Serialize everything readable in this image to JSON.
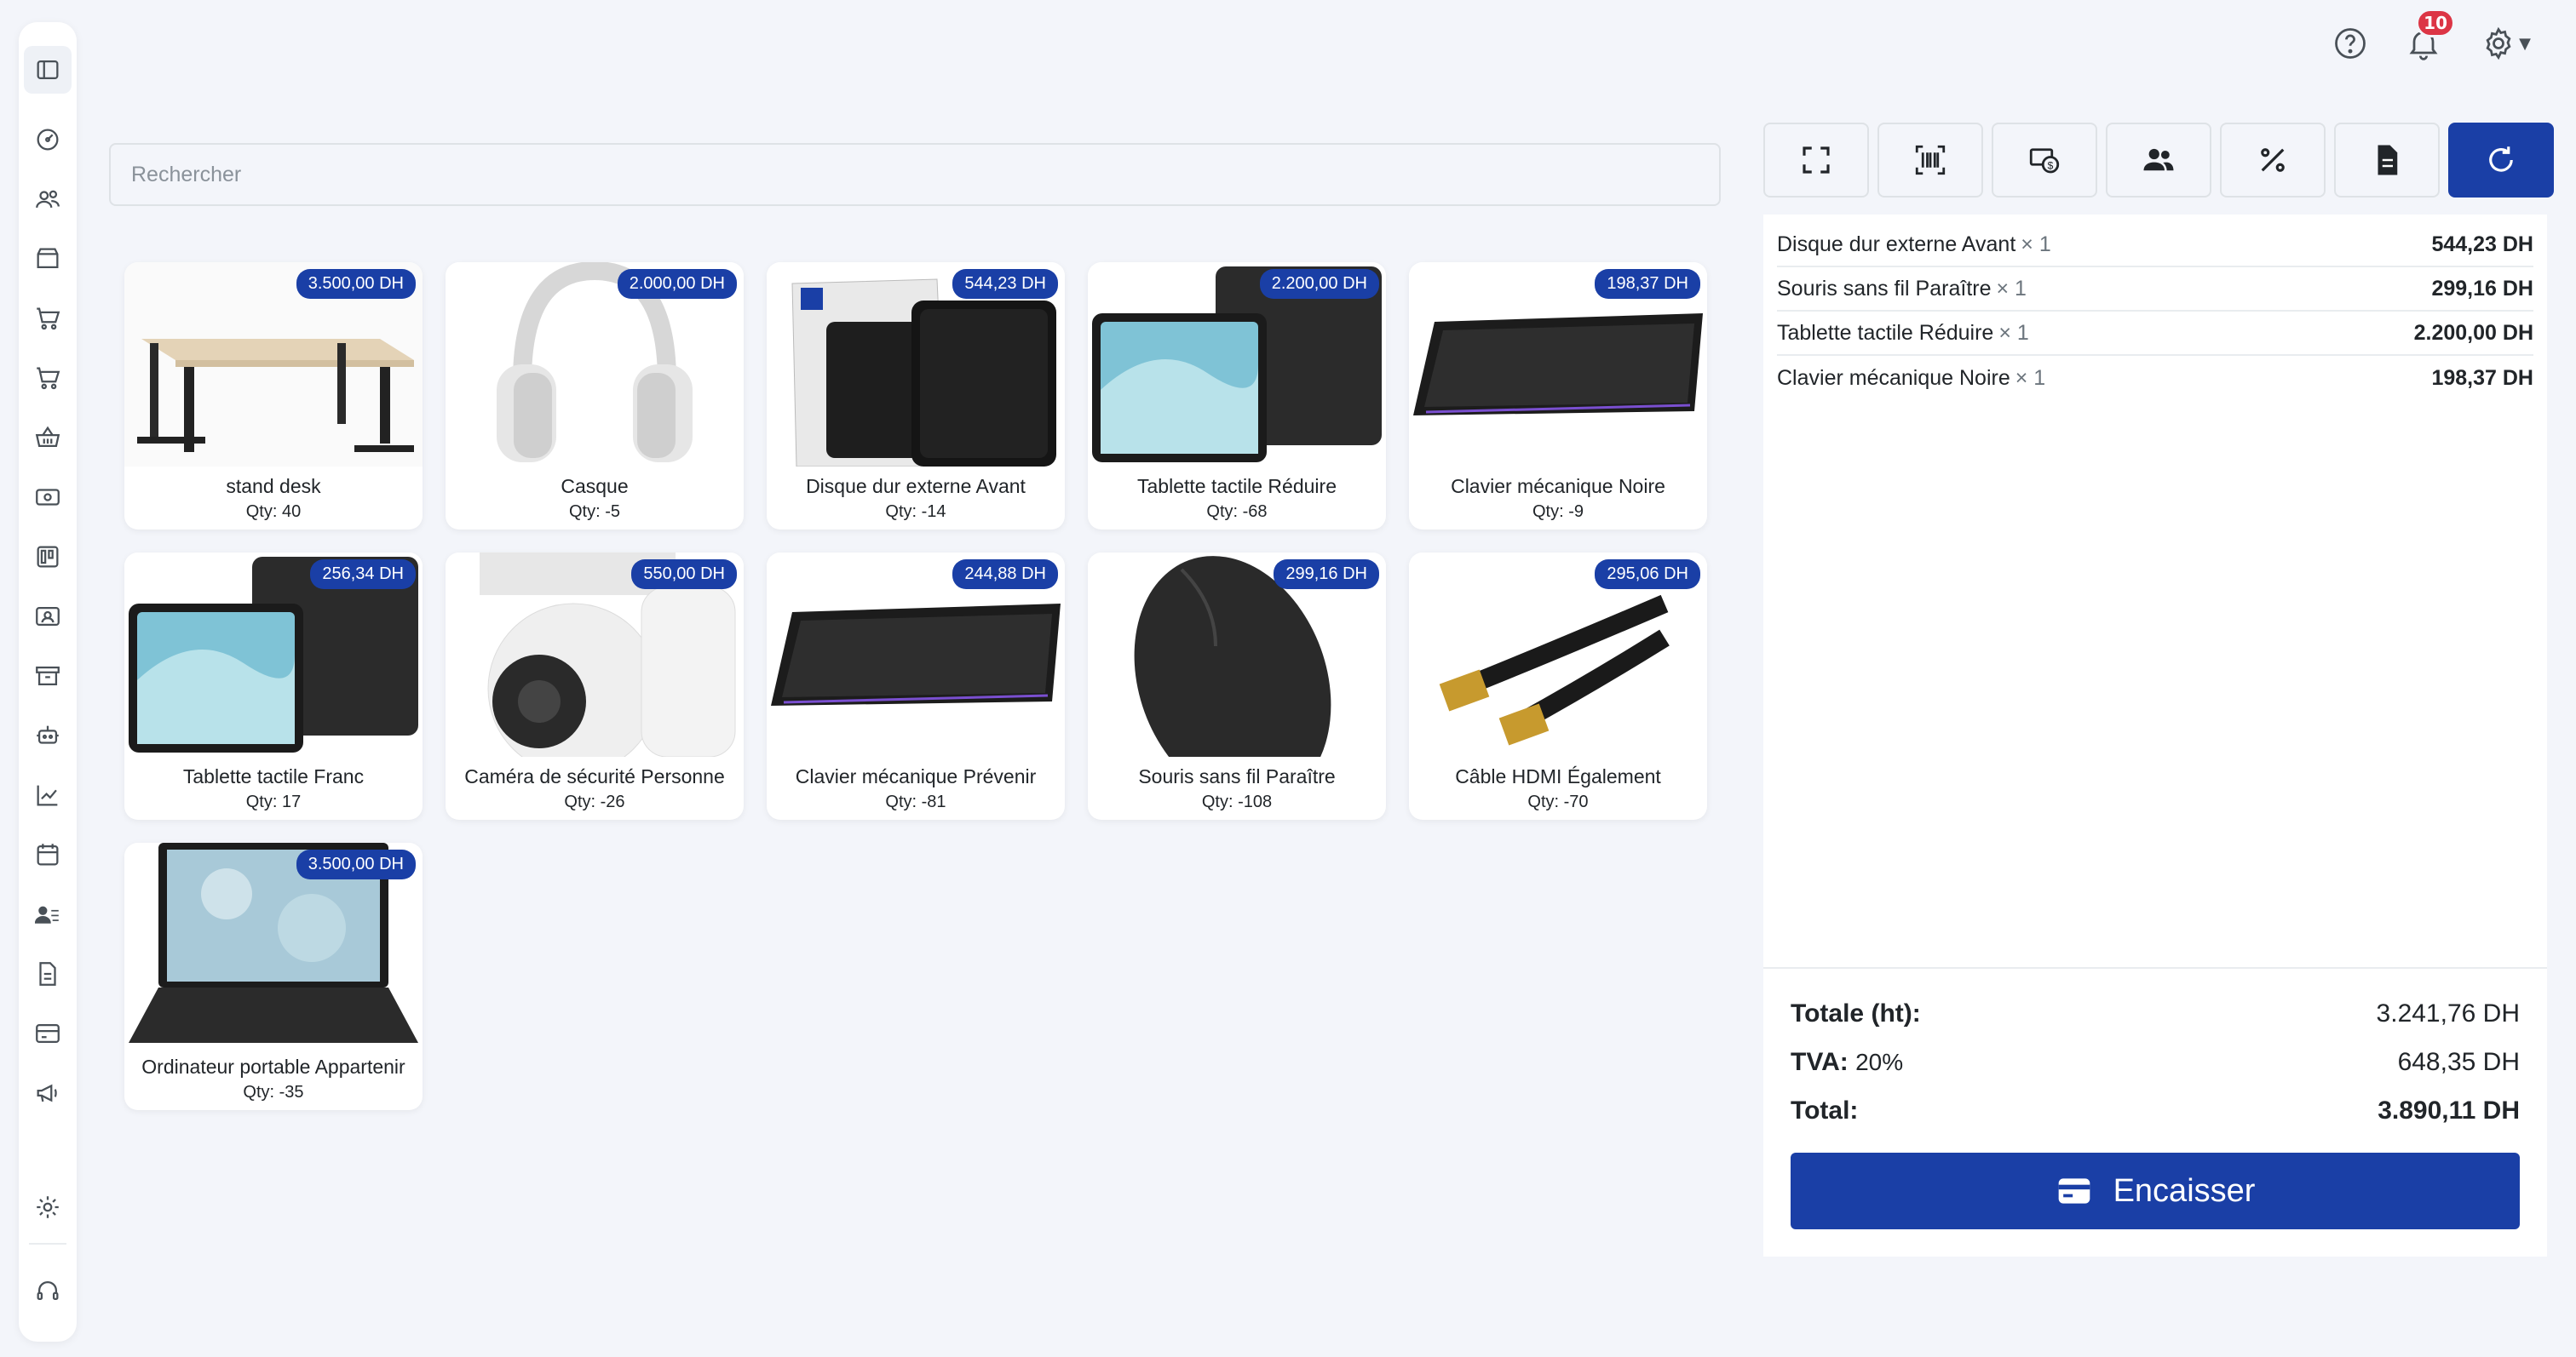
{
  "search": {
    "placeholder": "Rechercher"
  },
  "notifications": {
    "count": "10"
  },
  "products": [
    {
      "name": "stand desk",
      "qty": "Qty: 40",
      "price": "3.500,00 DH",
      "image": "desk"
    },
    {
      "name": "Casque",
      "qty": "Qty: -5",
      "price": "2.000,00 DH",
      "image": "headphones"
    },
    {
      "name": "Disque dur externe Avant",
      "qty": "Qty: -14",
      "price": "544,23 DH",
      "image": "hard-drive"
    },
    {
      "name": "Tablette tactile Réduire",
      "qty": "Qty: -68",
      "price": "2.200,00 DH",
      "image": "tablet"
    },
    {
      "name": "Clavier mécanique Noire",
      "qty": "Qty: -9",
      "price": "198,37 DH",
      "image": "keyboard"
    },
    {
      "name": "Tablette tactile Franc",
      "qty": "Qty: 17",
      "price": "256,34 DH",
      "image": "tablet"
    },
    {
      "name": "Caméra de sécurité Personne",
      "qty": "Qty: -26",
      "price": "550,00 DH",
      "image": "camera"
    },
    {
      "name": "Clavier mécanique Prévenir",
      "qty": "Qty: -81",
      "price": "244,88 DH",
      "image": "keyboard"
    },
    {
      "name": "Souris sans fil Paraître",
      "qty": "Qty: -108",
      "price": "299,16 DH",
      "image": "mouse"
    },
    {
      "name": "Câble HDMI Également",
      "qty": "Qty: -70",
      "price": "295,06 DH",
      "image": "hdmi-cable"
    },
    {
      "name": "Ordinateur portable Appartenir",
      "qty": "Qty: -35",
      "price": "3.500,00 DH",
      "image": "laptop"
    }
  ],
  "cart": {
    "items": [
      {
        "name": "Disque dur externe Avant",
        "qty": "× 1",
        "price": "544,23 DH"
      },
      {
        "name": "Souris sans fil Paraître",
        "qty": "× 1",
        "price": "299,16 DH"
      },
      {
        "name": "Tablette tactile Réduire",
        "qty": "× 1",
        "price": "2.200,00 DH"
      },
      {
        "name": "Clavier mécanique Noire",
        "qty": "× 1",
        "price": "198,37 DH"
      }
    ],
    "subtotal_label": "Totale (ht):",
    "subtotal_value": "3.241,76 DH",
    "tax_label": "TVA:",
    "tax_rate": "20%",
    "tax_value": "648,35 DH",
    "total_label": "Total:",
    "total_value": "3.890,11 DH",
    "pay_label": "Encaisser"
  },
  "colors": {
    "primary": "#1a3fa6",
    "badge": "#dc3545",
    "background": "#f3f5fa"
  }
}
